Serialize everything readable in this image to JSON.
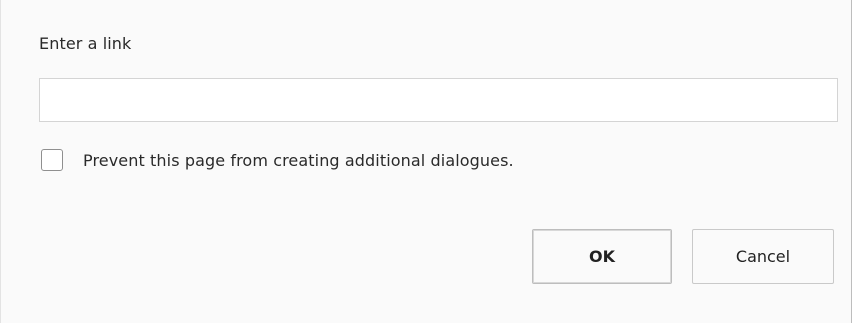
{
  "dialog": {
    "prompt_label": "Enter a link",
    "link_input": {
      "value": "",
      "placeholder": ""
    },
    "suppress_checkbox": {
      "checked": false,
      "label": "Prevent this page from creating additional dialogues."
    },
    "buttons": {
      "ok_label": "OK",
      "cancel_label": "Cancel"
    }
  },
  "colors": {
    "dialog_background": "#fafafa",
    "input_border": "#d4d4d4",
    "button_border": "#c9c9c9",
    "text": "#2a2a2a"
  }
}
